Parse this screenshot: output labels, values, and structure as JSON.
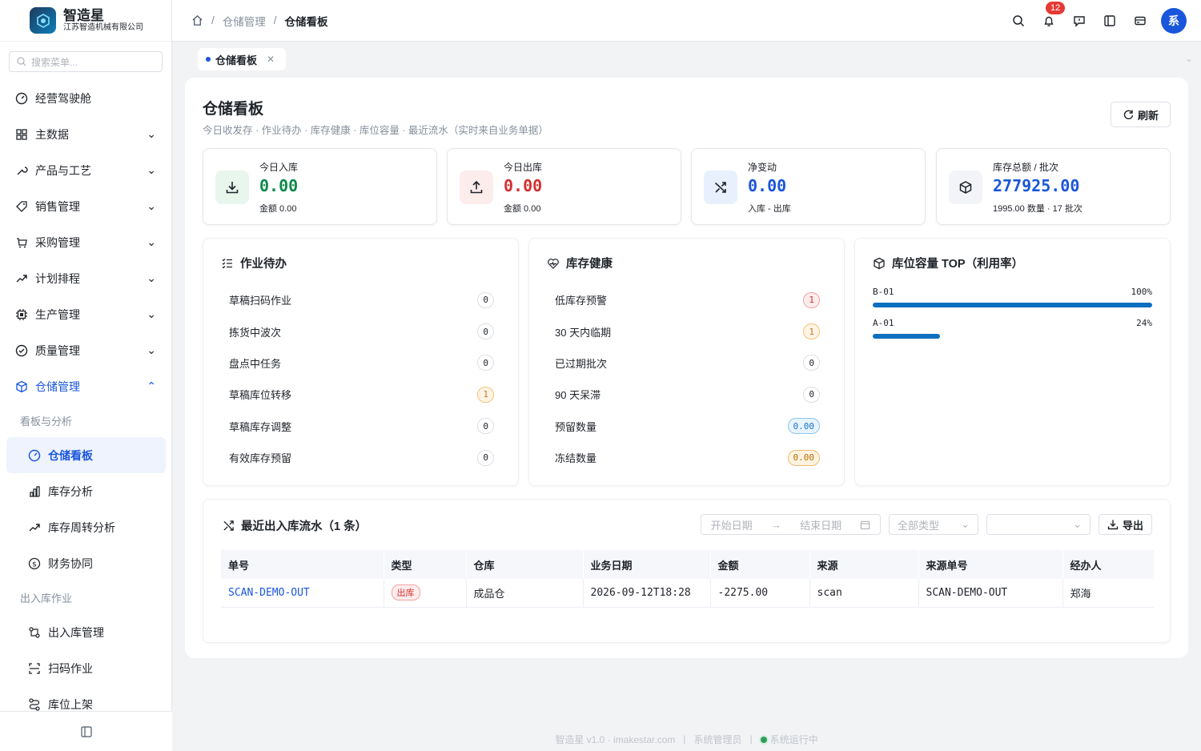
{
  "brand": {
    "name": "智造星",
    "company": "江苏智造机械有限公司"
  },
  "search": {
    "placeholder": "搜索菜单..."
  },
  "nav": {
    "items": [
      {
        "label": "经营驾驶舱",
        "icon": "dashboard-icon"
      },
      {
        "label": "主数据",
        "icon": "grid-icon"
      },
      {
        "label": "产品与工艺",
        "icon": "tool-icon"
      },
      {
        "label": "销售管理",
        "icon": "tag-icon"
      },
      {
        "label": "采购管理",
        "icon": "cart-icon"
      },
      {
        "label": "计划排程",
        "icon": "trend-icon"
      },
      {
        "label": "生产管理",
        "icon": "chip-icon"
      },
      {
        "label": "质量管理",
        "icon": "check-circle-icon"
      },
      {
        "label": "仓储管理",
        "icon": "box-icon"
      }
    ],
    "group1": "看板与分析",
    "sub1": [
      "仓储看板",
      "库存分析",
      "库存周转分析",
      "财务协同"
    ],
    "group2": "出入库作业",
    "sub2": [
      "出入库管理",
      "扫码作业",
      "库位上架"
    ]
  },
  "breadcrumb": {
    "level1": "仓储管理",
    "level2": "仓储看板"
  },
  "notifications": {
    "count": "12"
  },
  "user": {
    "avatar_text": "系"
  },
  "tab": {
    "label": "仓储看板"
  },
  "page": {
    "title": "仓储看板",
    "subtitle": "今日收发存 · 作业待办 · 库存健康 · 库位容量 · 最近流水（实时来自业务单据）",
    "refresh_label": "刷新"
  },
  "stats": [
    {
      "label": "今日入库",
      "value": "0.00",
      "sub": "金额 0.00",
      "color": "#0f8a4c"
    },
    {
      "label": "今日出库",
      "value": "0.00",
      "sub": "金额 0.00",
      "color": "#d32f2f"
    },
    {
      "label": "净变动",
      "value": "0.00",
      "sub": "入库 - 出库",
      "color": "#1a56db"
    },
    {
      "label": "库存总额 / 批次",
      "value": "277925.00",
      "sub": "1995.00 数量 · 17 批次",
      "color": "#1a56db"
    }
  ],
  "todo": {
    "title": "作业待办",
    "rows": [
      {
        "label": "草稿扫码作业",
        "value": "0"
      },
      {
        "label": "拣货中波次",
        "value": "0"
      },
      {
        "label": "盘点中任务",
        "value": "0"
      },
      {
        "label": "草稿库位转移",
        "value": "1"
      },
      {
        "label": "草稿库存调整",
        "value": "0"
      },
      {
        "label": "有效库存预留",
        "value": "0"
      }
    ]
  },
  "health": {
    "title": "库存健康",
    "rows": [
      {
        "label": "低库存预警",
        "value": "1"
      },
      {
        "label": "30 天内临期",
        "value": "1"
      },
      {
        "label": "已过期批次",
        "value": "0"
      },
      {
        "label": "90 天呆滞",
        "value": "0"
      },
      {
        "label": "预留数量",
        "value": "0.00"
      },
      {
        "label": "冻结数量",
        "value": "0.00"
      }
    ]
  },
  "capacity": {
    "title": "库位容量 TOP（利用率）",
    "rows": [
      {
        "name": "B-01",
        "pct_label": "100%",
        "utilization": 1.0
      },
      {
        "name": "A-01",
        "pct_label": "24%",
        "utilization": 0.24
      }
    ]
  },
  "flow": {
    "title": "最近出入库流水（1 条）",
    "start_placeholder": "开始日期",
    "end_placeholder": "结束日期",
    "type_placeholder": "全部类型",
    "export_label": "导出",
    "columns": [
      "单号",
      "类型",
      "仓库",
      "业务日期",
      "金额",
      "来源",
      "来源单号",
      "经办人"
    ],
    "rows": [
      {
        "no": "SCAN-DEMO-OUT",
        "type": "出库",
        "warehouse": "成品仓",
        "date": "2026-09-12T18:28",
        "amount": "-2275.00",
        "source": "scan",
        "source_no": "SCAN-DEMO-OUT",
        "handler": "郑海"
      }
    ]
  },
  "footer": {
    "version": "智造星 v1.0 · imakestar.com",
    "role": "系统管理员",
    "status": "系统运行中"
  }
}
